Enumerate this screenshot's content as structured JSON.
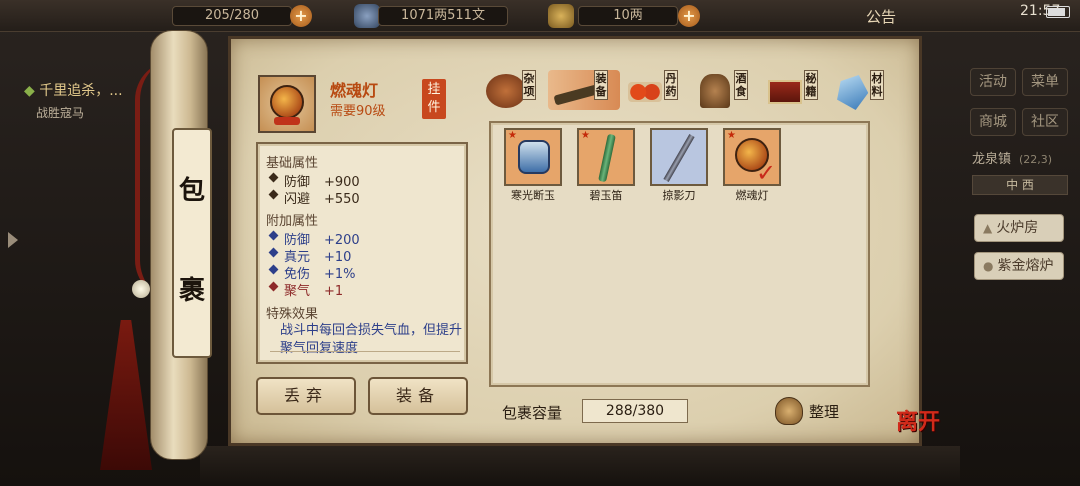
{
  "hud": {
    "stamina": "205/280",
    "copper": "1071两511文",
    "silver": "10两",
    "announcement": "公告",
    "time": "21:57"
  },
  "quest": {
    "title": "千里追杀，...",
    "subtitle": "战胜寇马"
  },
  "right_menu": {
    "activity": "活动",
    "menu": "菜单",
    "shop": "商城",
    "community": "社区",
    "town": "龙泉镇",
    "town_coord": "(22,3)",
    "direction": "中 西",
    "furnace": "火炉房",
    "purple_furnace": "紫金熔炉"
  },
  "scroll": {
    "char1": "包",
    "char2": "裹"
  },
  "selected_item": {
    "name": "燃魂灯",
    "requirement": "需要90级",
    "type_badge": "挂件",
    "icon": "lantern-icon"
  },
  "tabs": [
    {
      "label": "杂项",
      "icon": "pot-icon"
    },
    {
      "label": "装备",
      "icon": "weapon-icon",
      "active": true
    },
    {
      "label": "丹药",
      "icon": "pill-icon"
    },
    {
      "label": "酒食",
      "icon": "food-icon"
    },
    {
      "label": "秘籍",
      "icon": "book-icon"
    },
    {
      "label": "材料",
      "icon": "crystal-icon"
    }
  ],
  "attributes": {
    "base_title": "基础属性",
    "base": [
      {
        "name": "防御",
        "value": "+900"
      },
      {
        "name": "闪避",
        "value": "+550"
      }
    ],
    "extra_title": "附加属性",
    "extra": [
      {
        "name": "防御",
        "value": "+200",
        "color": "blue"
      },
      {
        "name": "真元",
        "value": "+10",
        "color": "blue"
      },
      {
        "name": "免伤",
        "value": "+1%",
        "color": "blue"
      },
      {
        "name": "聚气",
        "value": "+1",
        "color": "red"
      }
    ],
    "special_title": "特殊效果",
    "special_text": "战斗中每回合损失气血，但提升聚气回复速度"
  },
  "buttons": {
    "discard": "丢弃",
    "equip": "装备"
  },
  "inventory": [
    {
      "name": "寒光断玉",
      "icon": "jade-armor-icon",
      "bg": "#e6a56a",
      "starred": true
    },
    {
      "name": "碧玉笛",
      "icon": "jade-flute-icon",
      "bg": "#e6a56a",
      "starred": true
    },
    {
      "name": "掠影刀",
      "icon": "blade-icon",
      "bg": "#b9c6e0",
      "starred": false
    },
    {
      "name": "燃魂灯",
      "icon": "lantern-icon",
      "bg": "#e6a56a",
      "starred": true,
      "equipped": true
    }
  ],
  "capacity": {
    "label": "包裹容量",
    "value": "288/380"
  },
  "sort_label": "整理",
  "leave_label": "离开",
  "colors": {
    "accent_red": "#b84a12",
    "attr_blue": "#2d3f8a",
    "paper": "#e2d6b8"
  }
}
